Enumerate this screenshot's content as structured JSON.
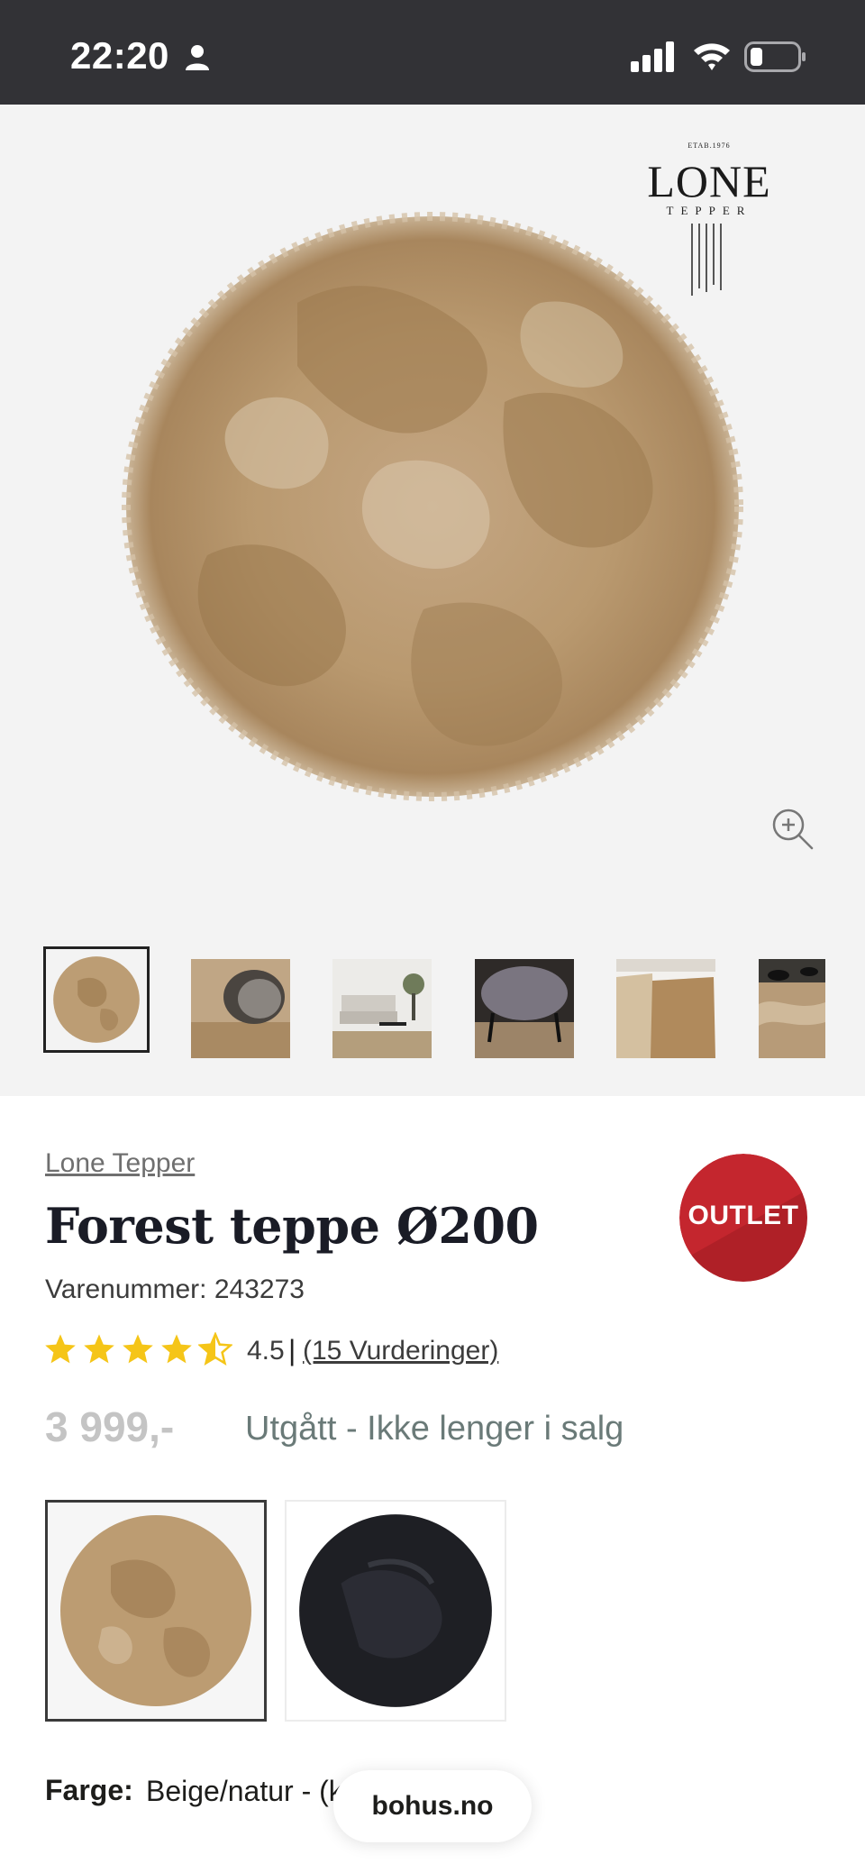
{
  "status_bar": {
    "time": "22:20",
    "icons": [
      "person-icon",
      "signal-icon",
      "wifi-icon",
      "battery-icon"
    ]
  },
  "gallery": {
    "logo": {
      "wordmark": "LONE",
      "subtitle": "TEPPER",
      "tagline": "ETAB.1976"
    },
    "main_image": "round-beige-shaggy-rug",
    "zoom_icon": "zoom-in-icon",
    "thumbnails": [
      {
        "name": "thumb-rug-top-view",
        "active": true
      },
      {
        "name": "thumb-rug-with-stool",
        "active": false
      },
      {
        "name": "thumb-living-room",
        "active": false
      },
      {
        "name": "thumb-dark-stool",
        "active": false
      },
      {
        "name": "thumb-rug-folded",
        "active": false
      },
      {
        "name": "thumb-rug-detail",
        "active": false
      }
    ]
  },
  "product": {
    "brand": "Lone Tepper",
    "title": "Forest teppe Ø200",
    "sku": "Varenummer: 243273",
    "badge": "OUTLET",
    "rating": {
      "value": "4.5",
      "stars": 4.5,
      "separator": "|",
      "count_label": "(15 Vurderinger)"
    },
    "price": "3 999,-",
    "stock_status": "Utgått - Ikke lenger i salg",
    "variants": [
      {
        "name": "beige",
        "selected": true
      },
      {
        "name": "black",
        "selected": false
      }
    ],
    "color_label": "Farge:",
    "color_value": "Beige/natur - (koobe)"
  },
  "browser": {
    "domain": "bohus.no"
  },
  "colors": {
    "status_bar": "#323236",
    "gallery_bg": "#f3f3f3",
    "badge_red": "#c4262e",
    "star": "#f5c518",
    "stock_text": "#6a7a78",
    "price_muted": "#c4c4c4"
  }
}
